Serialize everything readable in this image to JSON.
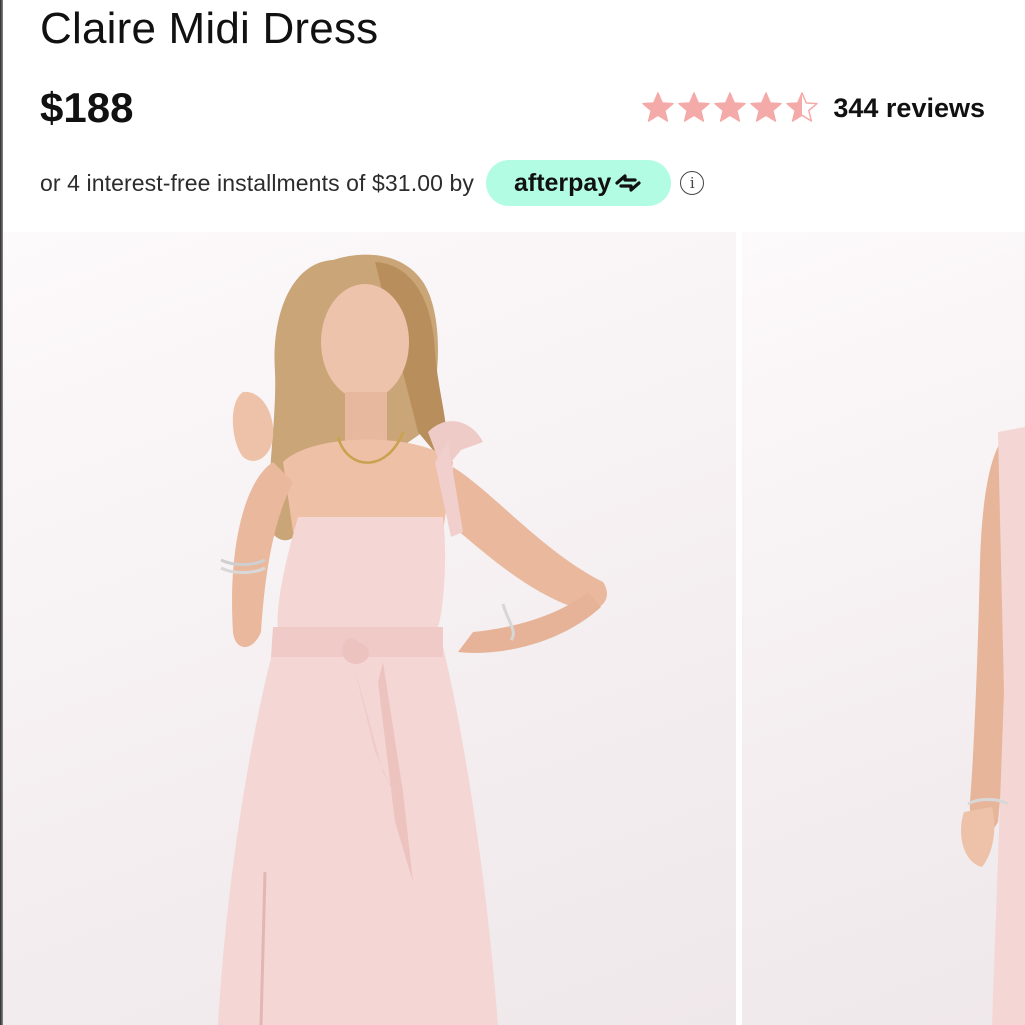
{
  "product": {
    "title": "Claire Midi Dress",
    "price": "$188"
  },
  "rating": {
    "value": 4.5,
    "max": 5,
    "star_color": "#f4aaa9",
    "reviews_label": "344 reviews"
  },
  "payment": {
    "installment_text": "or 4 interest-free installments of $31.00 by",
    "afterpay_label": "afterpay",
    "afterpay_color": "#b2fce4",
    "info_icon": "info-icon"
  },
  "gallery": {
    "images": [
      {
        "description": "model-front-pink-midi-dress"
      },
      {
        "description": "model-side-pink-midi-dress"
      }
    ],
    "dress_color": "#f4d6d4",
    "background_color": "#f7f2f3"
  }
}
